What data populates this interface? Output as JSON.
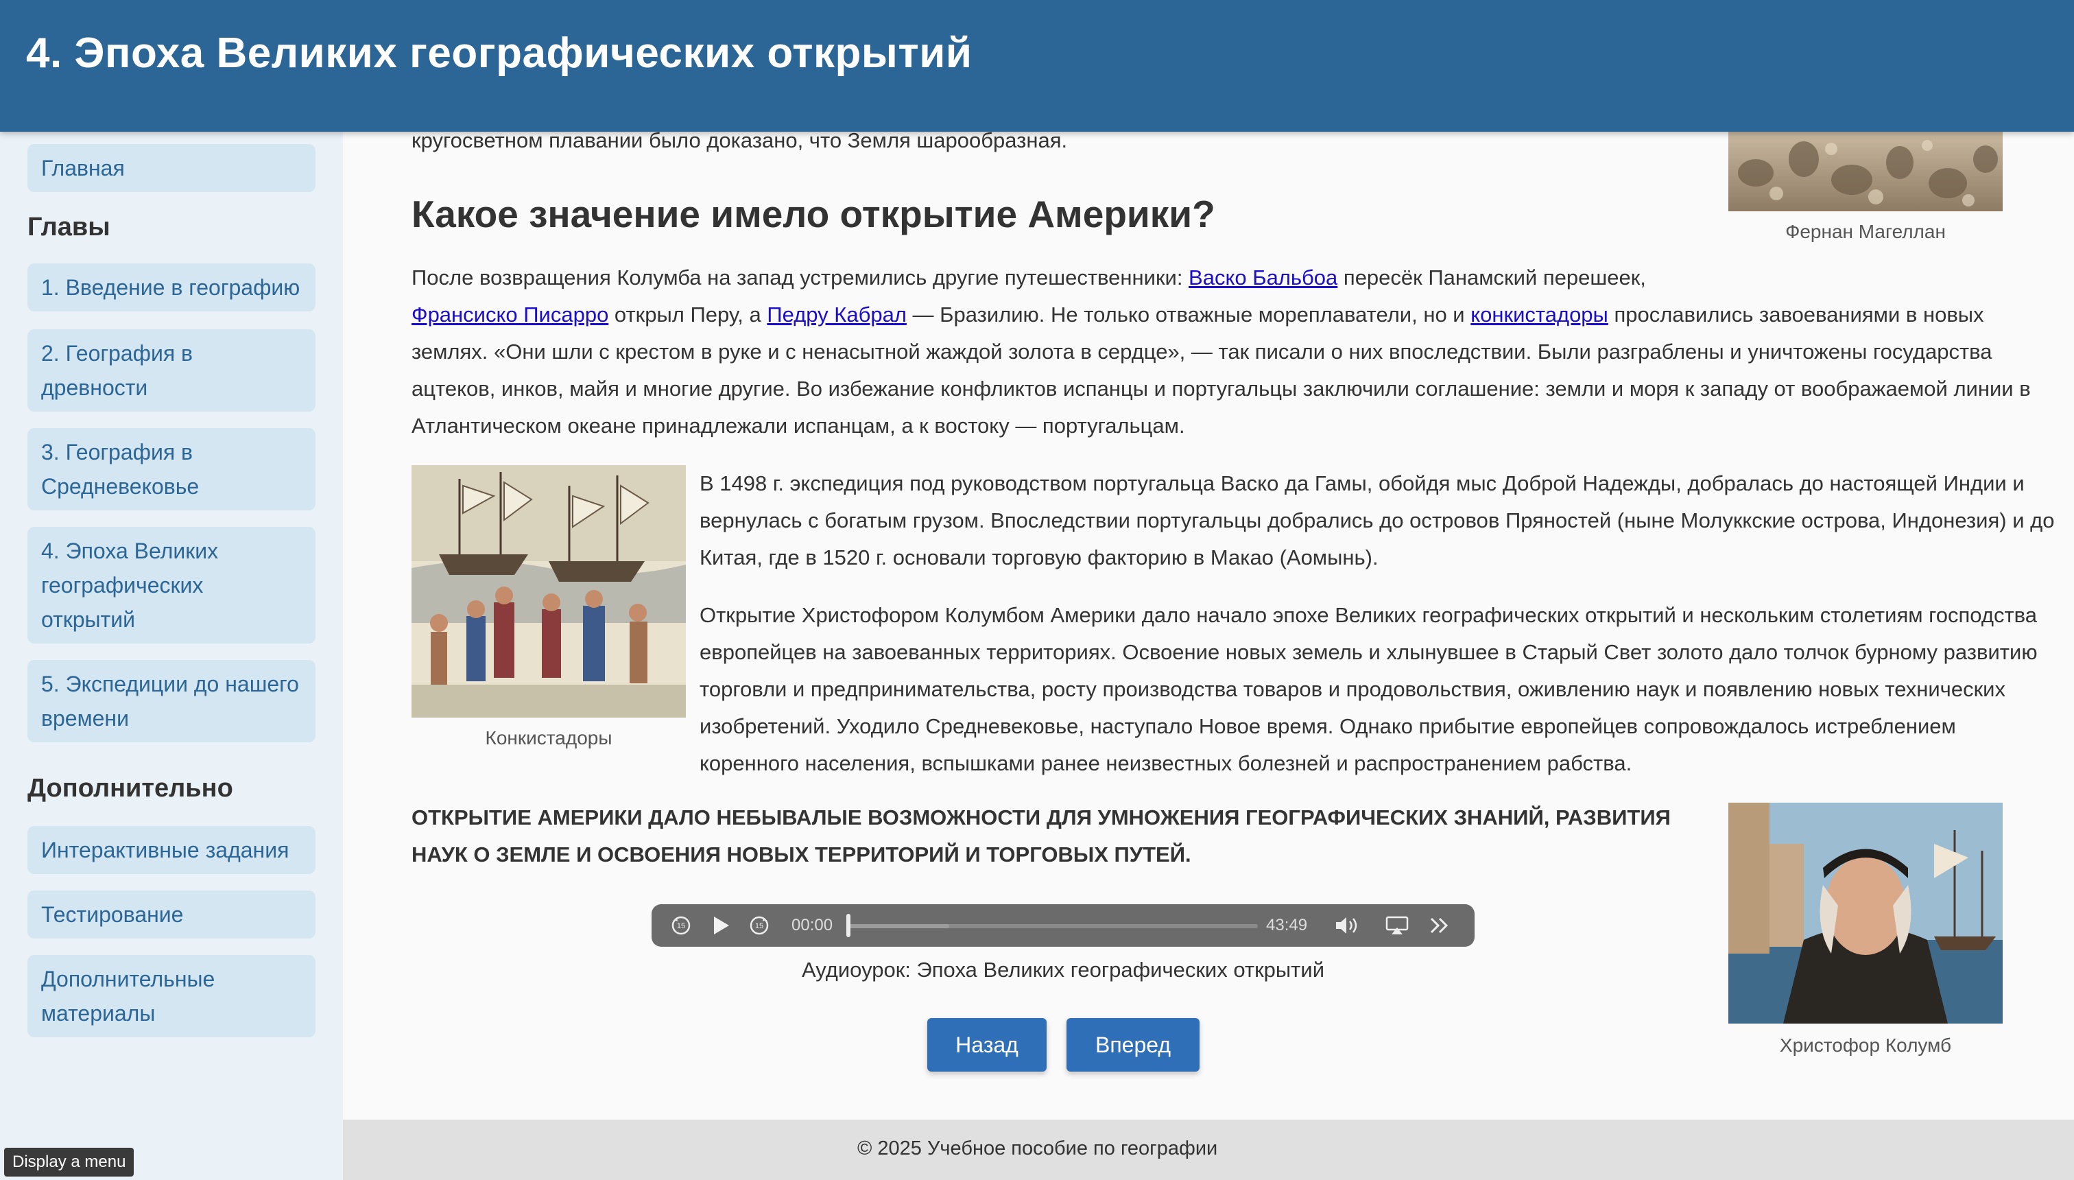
{
  "header": {
    "title": "4. Эпоха Великих географических открытий"
  },
  "sidebar": {
    "home": "Главная",
    "chapters_heading": "Главы",
    "chapters": [
      "1. Введение в географию",
      "2. География в древности",
      "3. География в Средневековье",
      "4. Эпоха Великих географических открытий",
      "5. Экспедиции до нашего времени"
    ],
    "extra_heading": "Дополнительно",
    "extra": [
      "Интерактивные задания",
      "Тестирование",
      "Дополнительные материалы"
    ]
  },
  "content": {
    "top_fragment": "кругосветном плавании было доказано, что Земля шарообразная.",
    "section_title": "Какое значение имело открытие Америки?",
    "para1": {
      "t1": "После возвращения Колумба на запад устремились другие путешественники: ",
      "link1": "Васко Бальбоа",
      "t2": " пересёк Панамский перешеек, ",
      "link2": "Франсиско Писарро",
      "t3": " открыл Перу, а ",
      "link3": "Педру Кабрал",
      "t4": " — Бразилию. Не только отважные мореплаватели, но и ",
      "link4": "конкистадоры",
      "t5": " прославились завоеваниями в новых землях. «Они шли с крестом в руке и с ненасытной жаждой золота в сердце», — так писали о них впоследствии. Были разграблены и уничтожены государства ацтеков, инков, майя и многие другие. Во избежание конфликтов испанцы и португальцы заключили соглашение: земли и моря к западу от воображаемой линии в Атлантическом океане принадлежали испанцам, а к востоку — португальцам."
    },
    "para2": "В 1498 г. экспедиция под руководством португальца Васко да Гамы, обойдя мыс Доброй Надежды, добралась до настоящей Индии и вернулась с богатым грузом. Впоследствии португальцы добрались до островов Пряностей (ныне Молуккские острова, Индонезия) и до Китая, где в 1520 г. основали торговую факторию в Макао (Аомынь).",
    "para3": "Открытие Христофором Колумбом Америки дало начало эпохе Великих географических открытий и нескольким столетиям господства европейцев на завоеванных территориях. Освоение новых земель и хлынувшее в Старый Свет золото дало толчок бурному развитию торговли и предпринимательства, росту производства товаров и продовольствия, оживлению наук и появлению новых технических изобретений. Уходило Средневековье, наступало Новое время. Однако прибытие европейцев сопровождалось истреблением коренного населения, вспышками ранее неизвестных болезней и распространением рабства.",
    "highlight": "Открытие Америки дало небывалые возможности для умножения географических знаний, развития наук о Земле и освоения новых территорий и торговых путей.",
    "captions": {
      "magellan": "Фернан Магеллан",
      "conquistadors": "Конкистадоры",
      "columbus": "Христофор Колумб"
    }
  },
  "audio": {
    "current_time": "00:00",
    "duration": "43:49",
    "played_fraction": 0.0,
    "buffered_fraction": 0.25,
    "label": "Аудиоурок: Эпоха Великих географических открытий",
    "icons": [
      "skip-back-15-icon",
      "play-icon",
      "skip-forward-15-icon",
      "volume-icon",
      "airplay-icon",
      "more-icon"
    ]
  },
  "nav_buttons": {
    "back": "Назад",
    "forward": "Вперед"
  },
  "footer": {
    "text": "© 2025 Учебное пособие по географии"
  },
  "tooltip": {
    "text": "Display a menu"
  },
  "colors": {
    "header": "#2c6696",
    "sidebar": "#eaf2f8",
    "nav_item": "#d3e6f2",
    "link": "#1a0dcc",
    "button": "#2e6fb8"
  }
}
